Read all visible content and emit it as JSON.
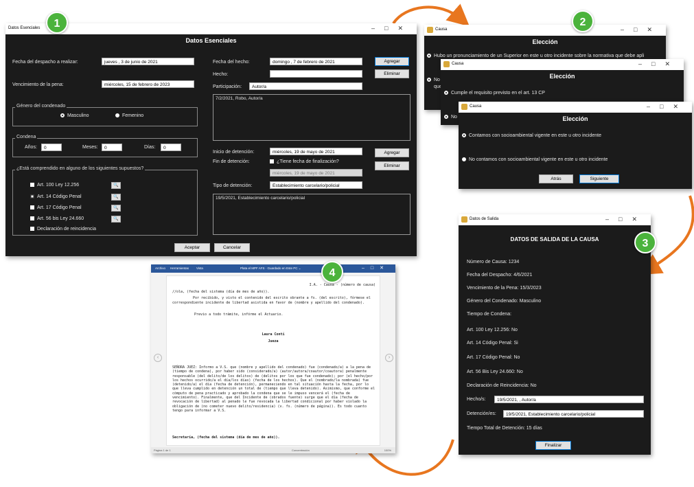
{
  "badges": [
    "1",
    "2",
    "3",
    "4"
  ],
  "win1": {
    "title": "Datos Esenciales",
    "heading": "Datos Esenciales",
    "fecha_despacho_label": "Fecha del despacho a realizar:",
    "fecha_despacho_value": "jueves    ,   3 de    junio    de 2021",
    "vencimiento_label": "Vencimiento de la pena:",
    "vencimiento_value": "miércoles, 15 de   febrero   de 2023",
    "genero_title": "Género del condenado",
    "masculino": "Masculino",
    "femenino": "Femenino",
    "condena_title": "Condena",
    "anios_label": "Años:",
    "anios_value": "0",
    "meses_label": "Meses:",
    "meses_value": "0",
    "dias_label": "Días:",
    "dias_value": "0",
    "supuestos_title": "¿Está comprendido en alguno de los siguientes supuestos?",
    "supuestos": [
      "Art. 100 Ley 12.256",
      "Art. 14 Código Penal",
      "Art. 17 Código Penal",
      "Art. 56 bis Ley 24.660",
      "Declaración de reincidencia"
    ],
    "fecha_hecho_label": "Fecha del hecho:",
    "fecha_hecho_value": "domingo  ,  7 de   febrero   de 2021",
    "hecho_label": "Hecho:",
    "participacion_label": "Participación:",
    "participacion_value": "Autor/a",
    "agregar": "Agregar",
    "eliminar": "Eliminar",
    "hechos_list": "7/2/2021, Robo, Autor/a",
    "inicio_label": "Inicio de detención:",
    "inicio_value": "miércoles, 19 de    mayo    de 2021",
    "fin_label": "Fin de detención:",
    "fin_check": "¿Tiene fecha de finalización?",
    "fin_value": "miércoles, 19 de    mayo    de 2021",
    "tipo_label": "Tipo de detención:",
    "tipo_value": "Establecimiento carcelario/policial",
    "detencion_list": "19/5/2021, Establecimiento carcelario/policial",
    "aceptar": "Aceptar",
    "cancelar": "Cancelar"
  },
  "win2a": {
    "title": "Causa",
    "heading": "Elección",
    "opt1": "Hubo un pronunciamiento de un Superior en este u otro incidente sobre la normativa que debe apli",
    "opt2": "No",
    "opt2b": "que"
  },
  "win2b": {
    "title": "Causa",
    "heading": "Elección",
    "opt1": "Cumple el requisito previsto en el art. 13 CP",
    "opt2": "No"
  },
  "win2c": {
    "title": "Causa",
    "heading": "Elección",
    "opt1": "Contamos con socioambiental vigente en este u otro incidente",
    "opt2": "No contamos con socioambiental vigente en este u otro incidente",
    "atras": "Atrás",
    "siguiente": "Siguiente"
  },
  "win3": {
    "title": "Datos de Salida",
    "heading": "DATOS DE SALIDA DE LA CAUSA",
    "rows": [
      "Número de Causa: 1234",
      "Fecha del Despacho: 4/6/2021",
      "Vencimiento de la Pena: 15/3/2023",
      "Género del Condenado: Masculino",
      "Tiempo de Condena:",
      "Art. 100 Ley 12.256: No",
      "Art. 14 Código Penal: Si",
      "Art. 17 Código Penal: No",
      "Art. 56 Bis Ley 24.660: No",
      "Declaración de Reincidencia: No"
    ],
    "hechos_label": "Hecho/s:",
    "hechos_value": "19/5/2021,  , Autor/a",
    "detenciones_label": "Detención/es:",
    "detenciones_value": "19/5/2021, Establecimiento carcelario/policial",
    "tiempo_total": "Tiempo Total de Detención: 15 días",
    "finalizar": "Finalizar"
  },
  "doc": {
    "menu": [
      "Archivo",
      "Herramientas",
      "Vista"
    ],
    "doc_title": "Plata el MPF AFS  ·  Guardado en Este PC  ⌄",
    "line1": "I.A. - Causa - (número de causa)",
    "line2": "//ola, (fecha del sistema (día de mes de año)).",
    "para1": "Por recibido, y visto el contenido del escrito obrante a fs. (del escrito), fórmese el correspondiente incidente de libertad asistida en favor de (nombre y apellido del condenado).",
    "para2": "Previo a todo trámite, infórme el Actuario.",
    "sign1": "Laura Conti",
    "sign2": "Jueza",
    "para3": "SEÑORA JUEZ: Informo a V.S. que (nombre y apellido del condenado) fue (condenado/a) a la pena de (tiempo de condena), por haber sido (considerado/a) (autor/autora/coautor/coautora) penalmente responsable (del delito/de los delitos) de (delitos por los que fue condenado); por (el hecho/por los hechos ocurrido/a el día/los días) (fecha de los hechos). Que el (nombrado/la nombrada) fue (detenido/a) el día (fecha de detención), permaneciendo en tal situación hasta la fecha, por lo que lleva cumplido en detención un total de (tiempo que lleva detenido). Asimismo, que conforme el cómputo de pena practicado y aprobado la condena que se le impuso vencerá el (fecha de vencimiento). Finalmente, que del Incidente de (obrados fuente) surge que el día (fecha de revocación de libertad) al penado le fue revocada la libertad condicional por haber violado la obligación de (no cometer nuevo delito/residencia) (v. fs. (número de página)). Es todo cuanto tengo para informar a V.S.",
    "para4": "Secretaría, (fecha del sistema (día de mes de año)).",
    "status_left": "Página 1 de 1",
    "status_right": "Concentración",
    "zoom": "100%"
  }
}
